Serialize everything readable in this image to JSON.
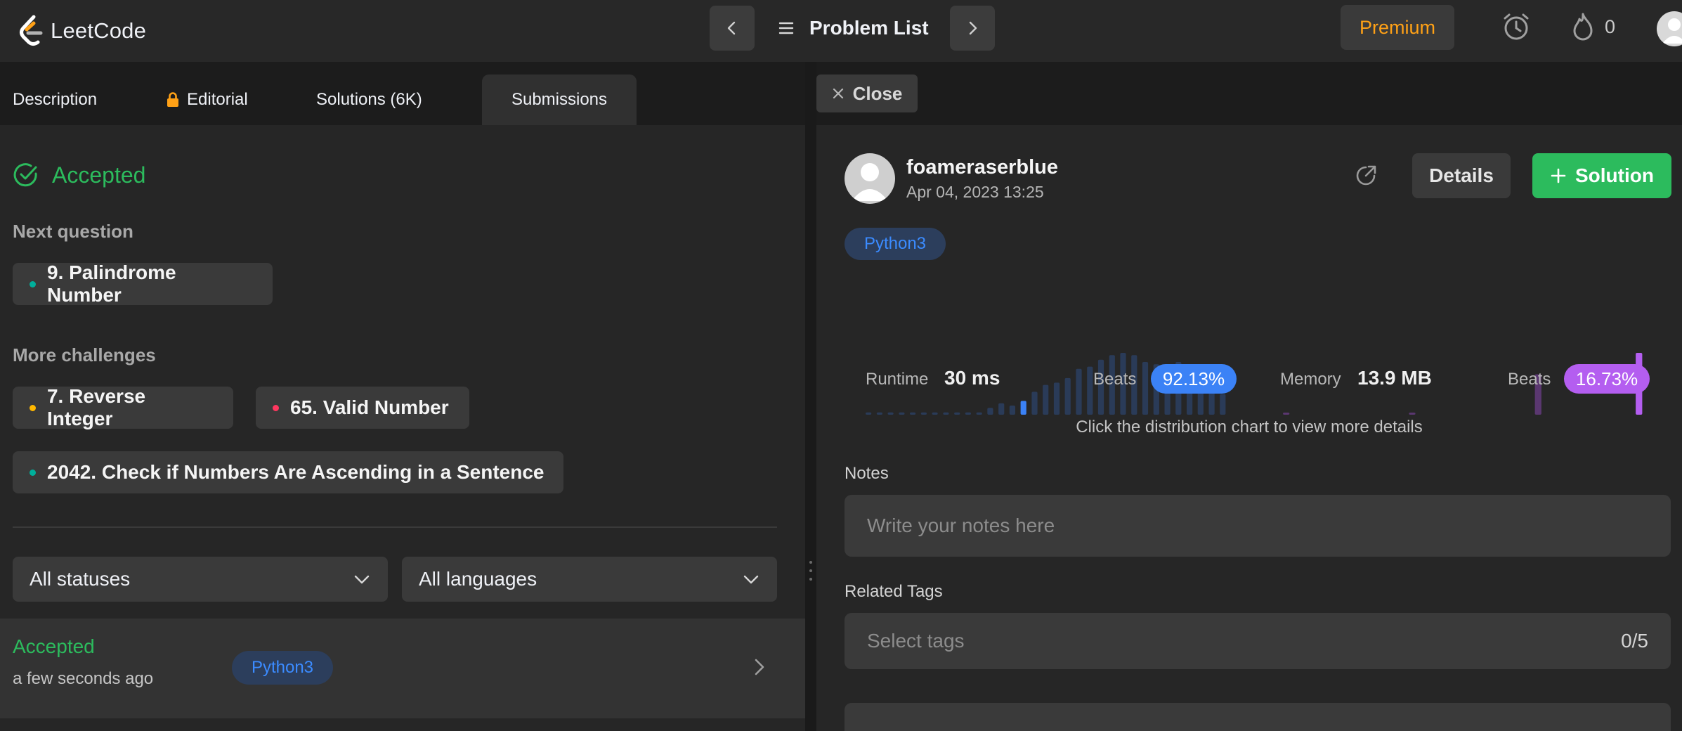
{
  "app": {
    "name": "LeetCode"
  },
  "nav": {
    "problem_list_label": "Problem List",
    "premium_label": "Premium",
    "streak_count": "0"
  },
  "tabs": [
    {
      "label": "Description",
      "locked": false
    },
    {
      "label": "Editorial",
      "locked": true
    },
    {
      "label": "Solutions (6K)",
      "locked": false
    },
    {
      "label": "Submissions",
      "locked": false,
      "active": true
    }
  ],
  "result": {
    "status": "Accepted",
    "next_question_label": "Next question",
    "next_question": {
      "title": "9. Palindrome Number",
      "difficulty_color": "#00af9b"
    },
    "more_challenges_label": "More challenges",
    "challenges": [
      {
        "title": "7. Reverse Integer",
        "difficulty_color": "#ffb800"
      },
      {
        "title": "65. Valid Number",
        "difficulty_color": "#ff375f"
      },
      {
        "title": "2042. Check if Numbers Are Ascending in a Sentence",
        "difficulty_color": "#00af9b"
      }
    ]
  },
  "filters": {
    "status": "All statuses",
    "language": "All languages"
  },
  "submissions": [
    {
      "status": "Accepted",
      "time": "a few seconds ago",
      "language": "Python3"
    }
  ],
  "detail": {
    "close_label": "Close",
    "username": "foameraserblue",
    "date": "Apr 04, 2023 13:25",
    "details_label": "Details",
    "solution_label": "Solution",
    "language": "Python3",
    "runtime_label": "Runtime",
    "runtime_value": "30 ms",
    "runtime_beats_label": "Beats",
    "runtime_beats": "92.13%",
    "memory_label": "Memory",
    "memory_value": "13.9 MB",
    "memory_beats_label": "Beats",
    "memory_beats": "16.73%",
    "hint": "Click the distribution chart to view more details",
    "notes_label": "Notes",
    "notes_placeholder": "Write your notes here",
    "tags_label": "Related Tags",
    "tags_placeholder": "Select tags",
    "tags_count": "0/5"
  },
  "colors": {
    "accent": "#ffa116",
    "accepted": "#2cbb5d",
    "runtime_highlight": "#3b82f6",
    "runtime_bar": "#2a3b58",
    "memory_highlight": "#b45ef0",
    "memory_bar": "#5a3770"
  },
  "chart_data": [
    {
      "type": "bar",
      "title": "",
      "series_name": "Runtime distribution",
      "values": [
        1,
        1,
        1,
        1,
        1,
        1,
        1,
        1,
        1,
        1,
        1,
        3,
        5,
        4,
        6,
        10,
        13,
        14,
        16,
        20,
        21,
        24,
        26,
        27,
        26,
        23,
        22,
        21,
        23,
        19,
        16,
        12,
        9
      ],
      "highlight_index": 14,
      "highlight_color": "#3b82f6"
    },
    {
      "type": "bar",
      "title": "",
      "series_name": "Memory distribution",
      "values": [
        0.5,
        0,
        0,
        0,
        0,
        0,
        0,
        0,
        0,
        0,
        0.5,
        0,
        0,
        0,
        0,
        0,
        0,
        0,
        0,
        0,
        17,
        0,
        0,
        0,
        0,
        0,
        0,
        0,
        26
      ],
      "highlight_index": 28,
      "highlight_color": "#b45ef0"
    }
  ]
}
